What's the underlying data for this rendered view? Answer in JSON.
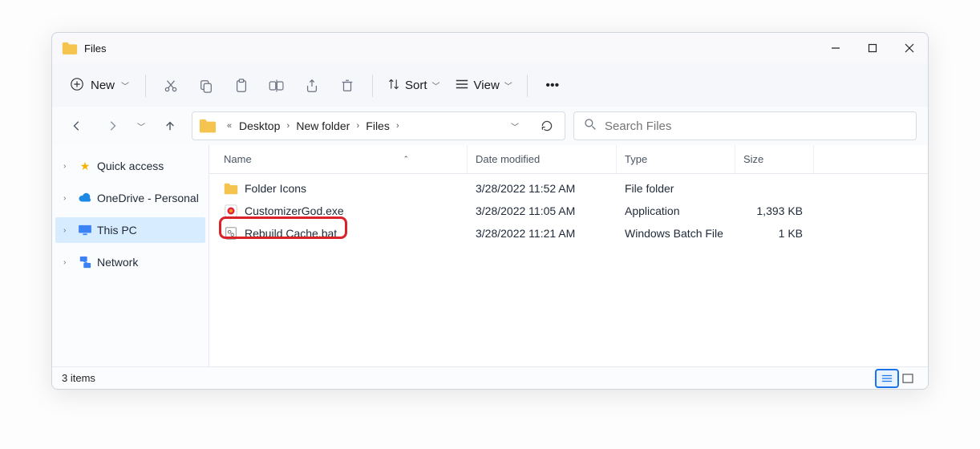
{
  "window": {
    "title": "Files"
  },
  "cmdbar": {
    "new_label": "New",
    "sort_label": "Sort",
    "view_label": "View"
  },
  "breadcrumbs": {
    "a": "Desktop",
    "b": "New folder",
    "c": "Files"
  },
  "search": {
    "placeholder": "Search Files"
  },
  "sidebar": {
    "items": [
      {
        "label": "Quick access"
      },
      {
        "label": "OneDrive - Personal"
      },
      {
        "label": "This PC"
      },
      {
        "label": "Network"
      }
    ]
  },
  "columns": {
    "name": "Name",
    "date": "Date modified",
    "type": "Type",
    "size": "Size"
  },
  "rows": [
    {
      "name": "Folder Icons",
      "date": "3/28/2022 11:52 AM",
      "type": "File folder",
      "size": ""
    },
    {
      "name": "CustomizerGod.exe",
      "date": "3/28/2022 11:05 AM",
      "type": "Application",
      "size": "1,393 KB"
    },
    {
      "name": "Rebuild Cache.bat",
      "date": "3/28/2022 11:21 AM",
      "type": "Windows Batch File",
      "size": "1 KB"
    }
  ],
  "status": {
    "text": "3 items"
  }
}
